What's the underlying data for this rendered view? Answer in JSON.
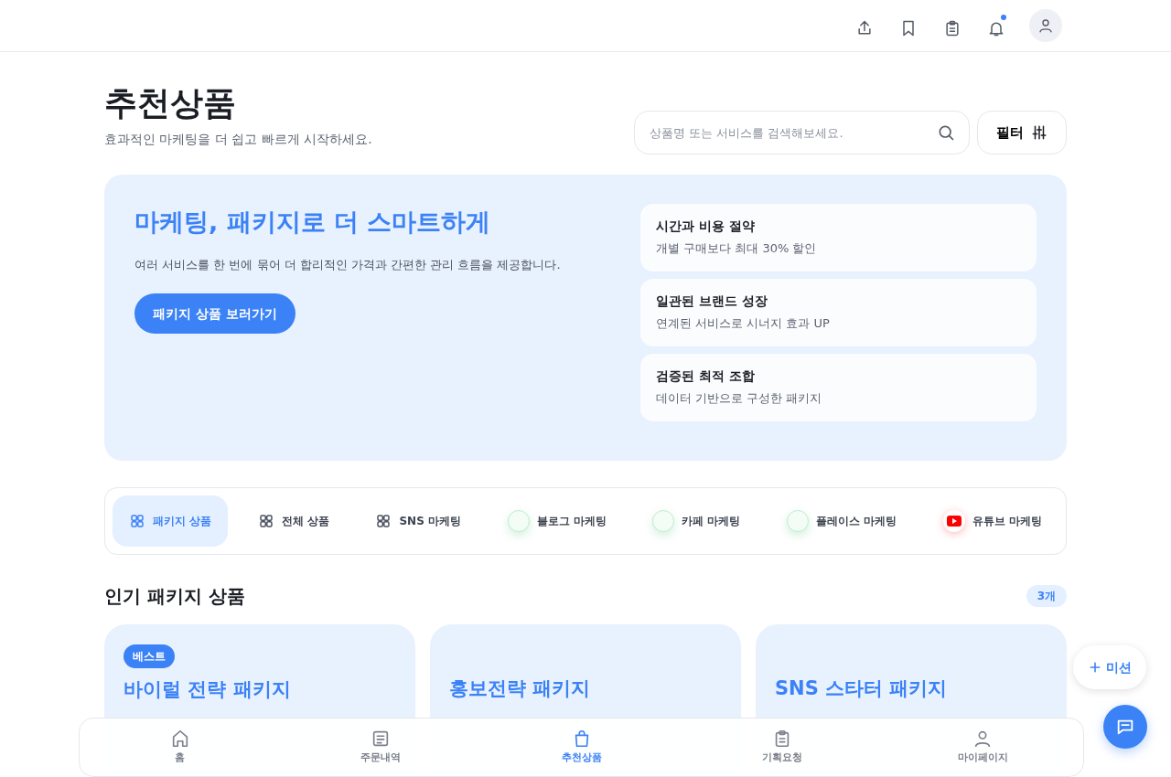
{
  "header": {
    "notification_unread": true
  },
  "page": {
    "title": "추천상품",
    "subtitle": "효과적인 마케팅을 더 쉽고 빠르게 시작하세요."
  },
  "search": {
    "placeholder": "상품명 또는 서비스를 검색해보세요."
  },
  "filter_button": "필터",
  "banner": {
    "title": "마케팅, 패키지로 더 스마트하게",
    "text": "여러 서비스를 한 번에 묶어 더 합리적인 가격과 간편한 관리 흐름을 제공합니다.",
    "button": "패키지 상품 보러가기",
    "features": [
      {
        "title": "시간과 비용 절약",
        "text": "개별 구매보다 최대 30% 할인"
      },
      {
        "title": "일관된 브랜드 성장",
        "text": "연계된 서비스로 시너지 효과 UP"
      },
      {
        "title": "검증된 최적 조합",
        "text": "데이터 기반으로 구성한 패키지"
      }
    ]
  },
  "categories": [
    {
      "label": "패키지 상품",
      "kind": "grid",
      "selected": true
    },
    {
      "label": "전체 상품",
      "kind": "grid",
      "selected": false
    },
    {
      "label": "SNS 마케팅",
      "kind": "grid",
      "selected": false
    },
    {
      "label": "블로그 마케팅",
      "kind": "circle",
      "selected": false
    },
    {
      "label": "카페 마케팅",
      "kind": "circle",
      "selected": false
    },
    {
      "label": "플레이스 마케팅",
      "kind": "circle",
      "selected": false
    },
    {
      "label": "유튜브 마케팅",
      "kind": "youtube",
      "selected": false
    }
  ],
  "section": {
    "title": "인기 패키지 상품",
    "count": "3개"
  },
  "packages": [
    {
      "badge": "베스트",
      "title": "바이럴 전략 패키지"
    },
    {
      "title": "홍보전략 패키지"
    },
    {
      "title": "SNS 스타터 패키지"
    }
  ],
  "mission_button": "미션",
  "bottom_nav": [
    {
      "label": "홈",
      "kind": "home",
      "selected": false
    },
    {
      "label": "주문내역",
      "kind": "list",
      "selected": false
    },
    {
      "label": "추천상품",
      "kind": "bag",
      "selected": true
    },
    {
      "label": "기획요청",
      "kind": "clipboard",
      "selected": false
    },
    {
      "label": "마이페이지",
      "kind": "user",
      "selected": false
    }
  ]
}
